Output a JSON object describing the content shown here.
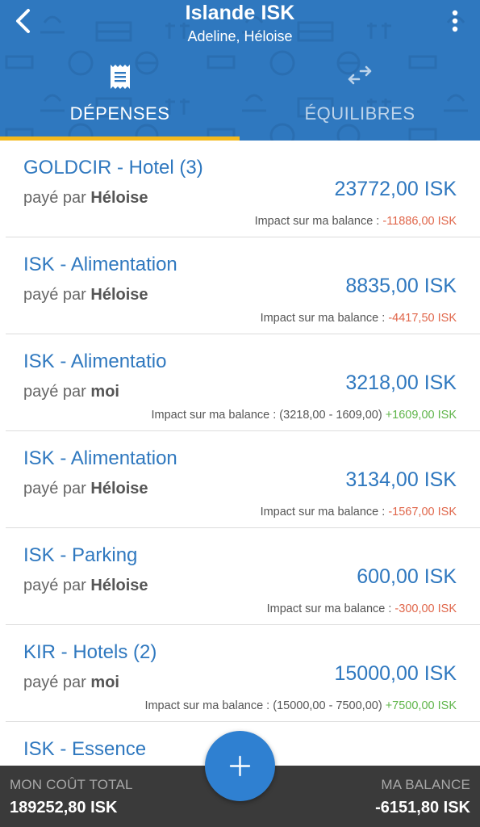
{
  "header": {
    "title": "Islande ISK",
    "subtitle": "Adeline, Héloise",
    "colors": {
      "primary": "#2f78bf",
      "accent": "#f4b91d"
    },
    "icons": {
      "back": "chevron-left-icon",
      "menu": "more-vertical-icon"
    }
  },
  "tabs": [
    {
      "label": "DÉPENSES",
      "icon": "receipt-icon",
      "active": true
    },
    {
      "label": "ÉQUILIBRES",
      "icon": "swap-arrows-icon",
      "active": false
    }
  ],
  "expenses": [
    {
      "title": "GOLDCIR - Hotel (3)",
      "paid_by_prefix": "payé par",
      "payer": "Héloise",
      "amount": "23772,00 ISK",
      "impact_label": "Impact sur ma balance :",
      "impact_detail": "",
      "impact_value": "-11886,00 ISK",
      "impact_sign": "neg"
    },
    {
      "title": "ISK - Alimentation",
      "paid_by_prefix": "payé par",
      "payer": "Héloise",
      "amount": "8835,00 ISK",
      "impact_label": "Impact sur ma balance :",
      "impact_detail": "",
      "impact_value": "-4417,50 ISK",
      "impact_sign": "neg"
    },
    {
      "title": "ISK - Alimentatio",
      "paid_by_prefix": "payé par",
      "payer": "moi",
      "amount": "3218,00 ISK",
      "impact_label": "Impact sur ma balance :",
      "impact_detail": "(3218,00 - 1609,00)",
      "impact_value": "+1609,00 ISK",
      "impact_sign": "pos"
    },
    {
      "title": "ISK - Alimentation",
      "paid_by_prefix": "payé par",
      "payer": "Héloise",
      "amount": "3134,00 ISK",
      "impact_label": "Impact sur ma balance :",
      "impact_detail": "",
      "impact_value": "-1567,00 ISK",
      "impact_sign": "neg"
    },
    {
      "title": "ISK - Parking",
      "paid_by_prefix": "payé par",
      "payer": "Héloise",
      "amount": "600,00 ISK",
      "impact_label": "Impact sur ma balance :",
      "impact_detail": "",
      "impact_value": "-300,00 ISK",
      "impact_sign": "neg"
    },
    {
      "title": "KIR - Hotels (2)",
      "paid_by_prefix": "payé par",
      "payer": "moi",
      "amount": "15000,00 ISK",
      "impact_label": "Impact sur ma balance :",
      "impact_detail": "(15000,00 - 7500,00)",
      "impact_value": "+7500,00 ISK",
      "impact_sign": "pos"
    },
    {
      "title": "ISK - Essence",
      "paid_by_prefix": "",
      "payer": "",
      "amount": "",
      "impact_label": "",
      "impact_detail": "",
      "impact_value": "",
      "impact_sign": ""
    }
  ],
  "footer": {
    "total_label": "MON COÛT TOTAL",
    "total_value": "189252,80 ISK",
    "balance_label": "MA BALANCE",
    "balance_value": "-6151,80 ISK"
  },
  "fab": {
    "icon": "plus-icon"
  }
}
